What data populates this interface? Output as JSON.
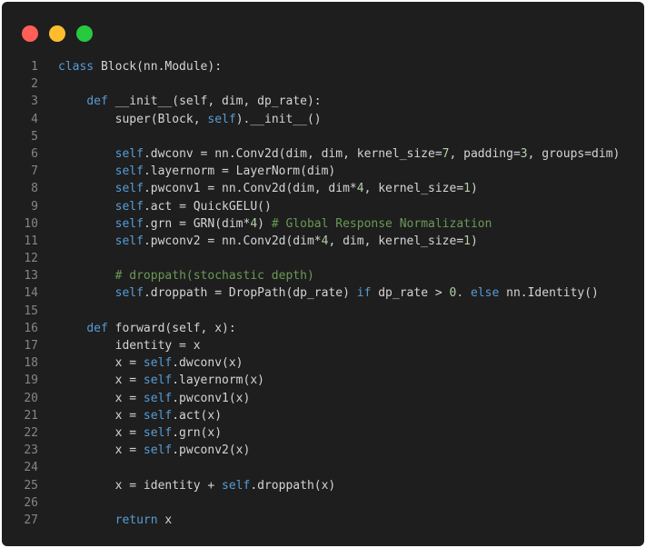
{
  "window": {
    "traffic_lights": [
      {
        "name": "close",
        "color": "#ff5f56"
      },
      {
        "name": "minimize",
        "color": "#ffbd2e"
      },
      {
        "name": "maximize",
        "color": "#27c93f"
      }
    ]
  },
  "colors": {
    "background": "#1e1e1e",
    "text": "#d4d4d4",
    "keyword": "#569cd6",
    "number": "#b5cea8",
    "comment": "#6a9955",
    "line_number": "#858585"
  },
  "code": {
    "lines": [
      {
        "n": "1",
        "tokens": [
          {
            "t": "kw",
            "v": "class"
          },
          {
            "t": "pl",
            "v": " Block(nn.Module):"
          }
        ]
      },
      {
        "n": "2",
        "tokens": []
      },
      {
        "n": "3",
        "tokens": [
          {
            "t": "pl",
            "v": "    "
          },
          {
            "t": "kw",
            "v": "def"
          },
          {
            "t": "pl",
            "v": " __init__(self, dim, dp_rate):"
          }
        ]
      },
      {
        "n": "4",
        "tokens": [
          {
            "t": "pl",
            "v": "        super(Block, "
          },
          {
            "t": "kw",
            "v": "self"
          },
          {
            "t": "pl",
            "v": ").__init__()"
          }
        ]
      },
      {
        "n": "5",
        "tokens": []
      },
      {
        "n": "6",
        "tokens": [
          {
            "t": "pl",
            "v": "        "
          },
          {
            "t": "kw",
            "v": "self"
          },
          {
            "t": "pl",
            "v": ".dwconv = nn.Conv2d(dim, dim, kernel_size="
          },
          {
            "t": "num",
            "v": "7"
          },
          {
            "t": "pl",
            "v": ", padding="
          },
          {
            "t": "num",
            "v": "3"
          },
          {
            "t": "pl",
            "v": ", groups=dim)"
          }
        ]
      },
      {
        "n": "7",
        "tokens": [
          {
            "t": "pl",
            "v": "        "
          },
          {
            "t": "kw",
            "v": "self"
          },
          {
            "t": "pl",
            "v": ".layernorm = LayerNorm(dim)"
          }
        ]
      },
      {
        "n": "8",
        "tokens": [
          {
            "t": "pl",
            "v": "        "
          },
          {
            "t": "kw",
            "v": "self"
          },
          {
            "t": "pl",
            "v": ".pwconv1 = nn.Conv2d(dim, dim*"
          },
          {
            "t": "num",
            "v": "4"
          },
          {
            "t": "pl",
            "v": ", kernel_size="
          },
          {
            "t": "num",
            "v": "1"
          },
          {
            "t": "pl",
            "v": ")"
          }
        ]
      },
      {
        "n": "9",
        "tokens": [
          {
            "t": "pl",
            "v": "        "
          },
          {
            "t": "kw",
            "v": "self"
          },
          {
            "t": "pl",
            "v": ".act = QuickGELU()"
          }
        ]
      },
      {
        "n": "10",
        "tokens": [
          {
            "t": "pl",
            "v": "        "
          },
          {
            "t": "kw",
            "v": "self"
          },
          {
            "t": "pl",
            "v": ".grn = GRN(dim*"
          },
          {
            "t": "num",
            "v": "4"
          },
          {
            "t": "pl",
            "v": ") "
          },
          {
            "t": "cm",
            "v": "# Global Response Normalization"
          }
        ]
      },
      {
        "n": "11",
        "tokens": [
          {
            "t": "pl",
            "v": "        "
          },
          {
            "t": "kw",
            "v": "self"
          },
          {
            "t": "pl",
            "v": ".pwconv2 = nn.Conv2d(dim*"
          },
          {
            "t": "num",
            "v": "4"
          },
          {
            "t": "pl",
            "v": ", dim, kernel_size="
          },
          {
            "t": "num",
            "v": "1"
          },
          {
            "t": "pl",
            "v": ")"
          }
        ]
      },
      {
        "n": "12",
        "tokens": []
      },
      {
        "n": "13",
        "tokens": [
          {
            "t": "pl",
            "v": "        "
          },
          {
            "t": "cm",
            "v": "# droppath(stochastic depth)"
          }
        ]
      },
      {
        "n": "14",
        "tokens": [
          {
            "t": "pl",
            "v": "        "
          },
          {
            "t": "kw",
            "v": "self"
          },
          {
            "t": "pl",
            "v": ".droppath = DropPath(dp_rate) "
          },
          {
            "t": "kw",
            "v": "if"
          },
          {
            "t": "pl",
            "v": " dp_rate > "
          },
          {
            "t": "num",
            "v": "0."
          },
          {
            "t": "pl",
            "v": " "
          },
          {
            "t": "kw",
            "v": "else"
          },
          {
            "t": "pl",
            "v": " nn.Identity()"
          }
        ]
      },
      {
        "n": "15",
        "tokens": []
      },
      {
        "n": "16",
        "tokens": [
          {
            "t": "pl",
            "v": "    "
          },
          {
            "t": "kw",
            "v": "def"
          },
          {
            "t": "pl",
            "v": " forward(self, x):"
          }
        ]
      },
      {
        "n": "17",
        "tokens": [
          {
            "t": "pl",
            "v": "        identity = x"
          }
        ]
      },
      {
        "n": "18",
        "tokens": [
          {
            "t": "pl",
            "v": "        x = "
          },
          {
            "t": "kw",
            "v": "self"
          },
          {
            "t": "pl",
            "v": ".dwconv(x)"
          }
        ]
      },
      {
        "n": "19",
        "tokens": [
          {
            "t": "pl",
            "v": "        x = "
          },
          {
            "t": "kw",
            "v": "self"
          },
          {
            "t": "pl",
            "v": ".layernorm(x)"
          }
        ]
      },
      {
        "n": "20",
        "tokens": [
          {
            "t": "pl",
            "v": "        x = "
          },
          {
            "t": "kw",
            "v": "self"
          },
          {
            "t": "pl",
            "v": ".pwconv1(x)"
          }
        ]
      },
      {
        "n": "21",
        "tokens": [
          {
            "t": "pl",
            "v": "        x = "
          },
          {
            "t": "kw",
            "v": "self"
          },
          {
            "t": "pl",
            "v": ".act(x)"
          }
        ]
      },
      {
        "n": "22",
        "tokens": [
          {
            "t": "pl",
            "v": "        x = "
          },
          {
            "t": "kw",
            "v": "self"
          },
          {
            "t": "pl",
            "v": ".grn(x)"
          }
        ]
      },
      {
        "n": "23",
        "tokens": [
          {
            "t": "pl",
            "v": "        x = "
          },
          {
            "t": "kw",
            "v": "self"
          },
          {
            "t": "pl",
            "v": ".pwconv2(x)"
          }
        ]
      },
      {
        "n": "24",
        "tokens": []
      },
      {
        "n": "25",
        "tokens": [
          {
            "t": "pl",
            "v": "        x = identity + "
          },
          {
            "t": "kw",
            "v": "self"
          },
          {
            "t": "pl",
            "v": ".droppath(x)"
          }
        ]
      },
      {
        "n": "26",
        "tokens": []
      },
      {
        "n": "27",
        "tokens": [
          {
            "t": "pl",
            "v": "        "
          },
          {
            "t": "kw",
            "v": "return"
          },
          {
            "t": "pl",
            "v": " x"
          }
        ]
      }
    ]
  }
}
